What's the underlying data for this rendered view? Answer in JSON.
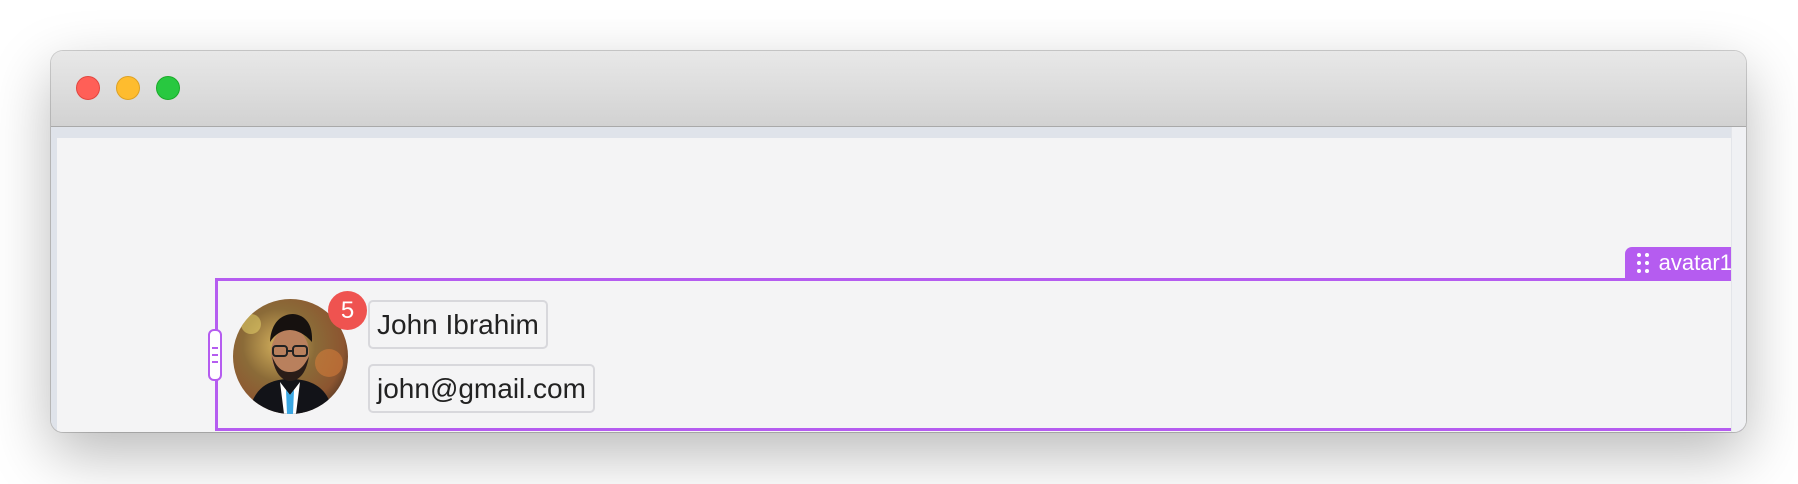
{
  "window": {
    "controls": [
      "close",
      "minimize",
      "zoom"
    ],
    "colors": {
      "close": "#ff5f57",
      "minimize": "#febc2e",
      "zoom": "#28c840"
    }
  },
  "component": {
    "tag_label": "avatar1",
    "tag_icon": "drag-handle-icon",
    "accent_color": "#b55cf0"
  },
  "avatar": {
    "badge_count": "5",
    "badge_color": "#ef5350",
    "name": "John Ibrahim",
    "email": "john@gmail.com"
  }
}
